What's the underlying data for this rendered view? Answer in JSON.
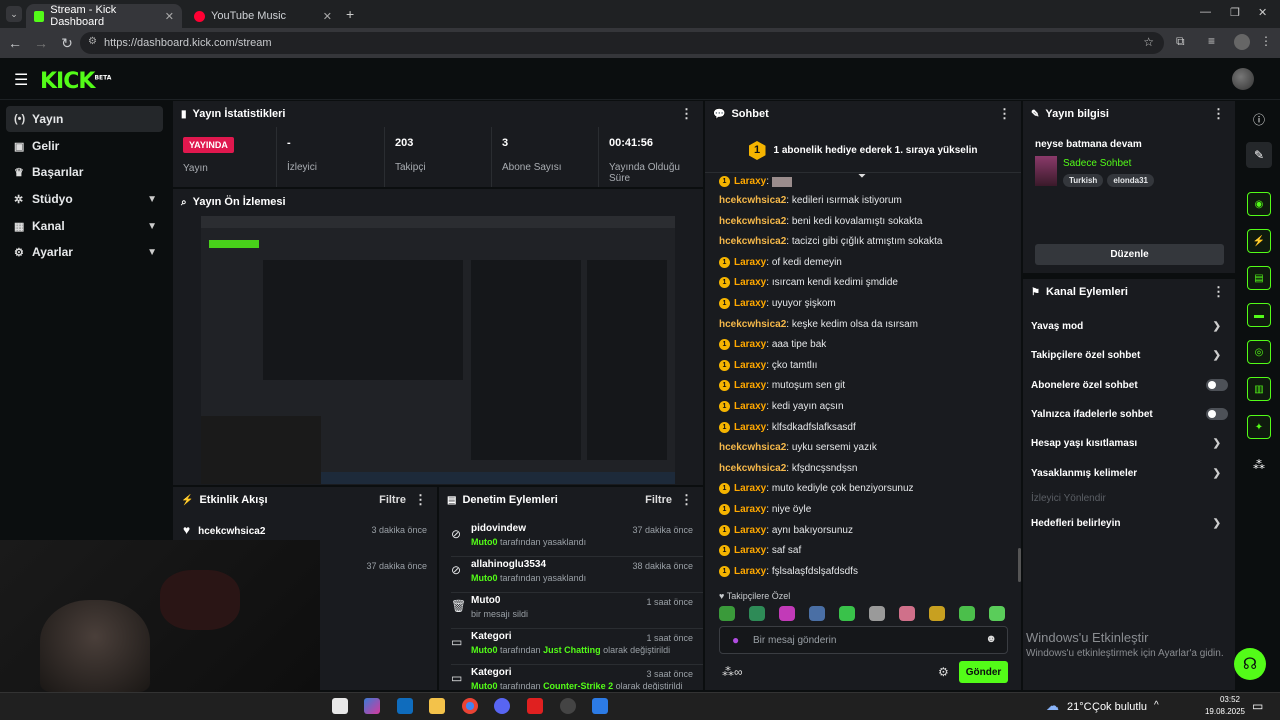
{
  "browser": {
    "tabs": [
      {
        "title": "Stream - Kick Dashboard",
        "active": true
      },
      {
        "title": "YouTube Music",
        "active": false
      }
    ],
    "url": "https://dashboard.kick.com/stream"
  },
  "brand": {
    "logo": "KICK",
    "logo_sup": "BETA",
    "accent": "#53fc18"
  },
  "sidebar": {
    "items": [
      {
        "label": "Yayın",
        "icon": "broadcast-icon",
        "active": true
      },
      {
        "label": "Gelir",
        "icon": "wallet-icon"
      },
      {
        "label": "Başarılar",
        "icon": "trophy-icon"
      },
      {
        "label": "Stüdyo",
        "icon": "studio-icon",
        "expandable": true
      },
      {
        "label": "Kanal",
        "icon": "channel-icon",
        "expandable": true
      },
      {
        "label": "Ayarlar",
        "icon": "gear-icon",
        "expandable": true
      }
    ]
  },
  "stats": {
    "title": "Yayın İstatistikleri",
    "live_badge": "YAYINDA",
    "items": [
      {
        "value": "",
        "label": "Yayın"
      },
      {
        "value": "-",
        "label": "İzleyici"
      },
      {
        "value": "203",
        "label": "Takipçi"
      },
      {
        "value": "3",
        "label": "Abone Sayısı"
      },
      {
        "value": "00:41:56",
        "label": "Yayında Olduğu Süre"
      }
    ]
  },
  "preview": {
    "title": "Yayın Ön İzlemesi"
  },
  "activity": {
    "title": "Etkinlik Akışı",
    "filter": "Filtre",
    "items": [
      {
        "name": "hcekcwhsica2",
        "time": "3 dakika önce"
      },
      {
        "name": "",
        "time": "37 dakika önce"
      }
    ]
  },
  "moderation": {
    "title": "Denetim Eylemleri",
    "filter": "Filtre",
    "items": [
      {
        "title": "pidovindew",
        "actor": "Muto0",
        "rest": "tarafından yasaklandı",
        "time": "37 dakika önce"
      },
      {
        "title": "allahinoglu3534",
        "actor": "Muto0",
        "rest": "tarafından yasaklandı",
        "time": "38 dakika önce"
      },
      {
        "title": "Muto0",
        "actor": "",
        "rest": "bir mesajı sildi",
        "time": "1 saat önce"
      },
      {
        "title": "Kategori",
        "actor": "Muto0",
        "rest": "tarafından",
        "cat": "Just Chatting",
        "rest2": "olarak değiştirildi",
        "time": "1 saat önce"
      },
      {
        "title": "Kategori",
        "actor": "Muto0",
        "rest": "tarafından",
        "cat": "Counter-Strike 2",
        "rest2": "olarak değiştirildi",
        "time": "3 saat önce"
      }
    ]
  },
  "chat": {
    "title": "Sohbet",
    "pinned": "1 abonelik hediye ederek 1. sıraya yükselin",
    "pinned_rank": "1",
    "partial_user": "Laraxy",
    "messages": [
      {
        "user": "hcekcwhsica2",
        "text": "kedileri ısırmak istiyorum",
        "badge": false
      },
      {
        "user": "hcekcwhsica2",
        "text": "beni kedi kovalamıştı sokakta",
        "badge": false
      },
      {
        "user": "hcekcwhsica2",
        "text": "tacizci gibi çığlık atmıştım sokakta",
        "badge": false
      },
      {
        "user": "Laraxy",
        "text": "of kedi demeyin",
        "badge": true
      },
      {
        "user": "Laraxy",
        "text": "ısırcam kendi kedimi şmdide",
        "badge": true
      },
      {
        "user": "Laraxy",
        "text": "uyuyor şişkom",
        "badge": true
      },
      {
        "user": "hcekcwhsica2",
        "text": "keşke kedim olsa da ısırsam",
        "badge": false
      },
      {
        "user": "Laraxy",
        "text": "aaa tipe bak",
        "badge": true
      },
      {
        "user": "Laraxy",
        "text": "çko tamtlıı",
        "badge": true
      },
      {
        "user": "Laraxy",
        "text": "mutoşum sen git",
        "badge": true
      },
      {
        "user": "Laraxy",
        "text": "kedi yayın açsın",
        "badge": true
      },
      {
        "user": "Laraxy",
        "text": "klfsdkadfslafksasdf",
        "badge": true
      },
      {
        "user": "hcekcwhsica2",
        "text": "uyku sersemi yazık",
        "badge": false
      },
      {
        "user": "hcekcwhsica2",
        "text": "kfşdncşsndşsn",
        "badge": false
      },
      {
        "user": "Laraxy",
        "text": "muto kediyle çok benziyorsunuz",
        "badge": true
      },
      {
        "user": "Laraxy",
        "text": "niye öyle",
        "badge": true
      },
      {
        "user": "Laraxy",
        "text": "aynı bakıyorsunuz",
        "badge": true
      },
      {
        "user": "Laraxy",
        "text": "saf saf",
        "badge": true
      },
      {
        "user": "Laraxy",
        "text": "fşlsalaşfdslşafdsdfs",
        "badge": true
      }
    ],
    "emote_section": "Takipçilere Özel",
    "input_placeholder": "Bir mesaj gönderin",
    "send": "Gönder"
  },
  "stream_info": {
    "title": "Yayın bilgisi",
    "stream_title": "neyse batmana devam",
    "category": "Sadece Sohbet",
    "tags": [
      "Turkish",
      "elonda31"
    ],
    "edit": "Düzenle"
  },
  "channel_actions": {
    "title": "Kanal Eylemleri",
    "items": [
      {
        "label": "Yavaş mod",
        "kind": "arrow"
      },
      {
        "label": "Takipçilere özel sohbet",
        "kind": "arrow"
      },
      {
        "label": "Abonelere özel sohbet",
        "kind": "toggle",
        "on": false
      },
      {
        "label": "Yalnızca ifadelerle sohbet",
        "kind": "toggle",
        "on": false
      },
      {
        "label": "Hesap yaşı kısıtlaması",
        "kind": "arrow"
      },
      {
        "label": "Yasaklanmış kelimeler",
        "kind": "arrow"
      },
      {
        "label": "İzleyici Yönlendir",
        "kind": "disabled"
      },
      {
        "label": "Hedefleri belirleyin",
        "kind": "arrow"
      }
    ]
  },
  "watermark": {
    "line1": "Windows'u Etkinleştir",
    "line2": "Windows'u etkinleştirmek için Ayarlar'a gidin."
  },
  "taskbar": {
    "temp": "21°C",
    "weather": "Çok bulutlu",
    "time": "03:52",
    "date": "19.08.2025"
  }
}
